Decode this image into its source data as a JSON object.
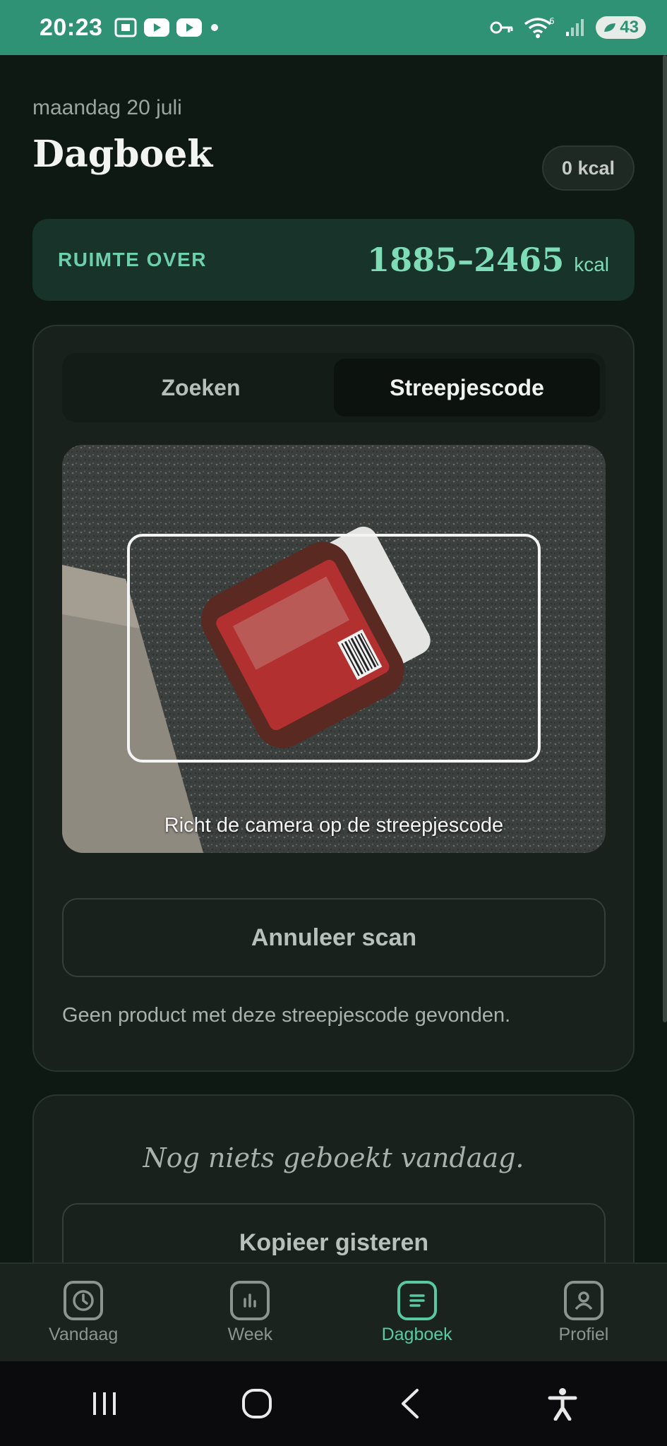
{
  "status_bar": {
    "time": "20:23",
    "battery": "43",
    "wifi_badge": "6"
  },
  "header": {
    "date": "maandag 20 juli",
    "title": "Dagboek",
    "kcal_pill": "0 kcal"
  },
  "remaining": {
    "label": "RUIMTE OVER",
    "value": "1885–2465",
    "unit": "kcal"
  },
  "scanner": {
    "tabs": [
      {
        "label": "Zoeken",
        "active": false
      },
      {
        "label": "Streepjescode",
        "active": true
      }
    ],
    "camera_hint": "Richt de camera op de streepjescode",
    "cancel_label": "Annuleer scan",
    "message": "Geen product met deze streepjescode gevonden."
  },
  "log": {
    "empty_text": "Nog niets geboekt vandaag.",
    "copy_label": "Kopieer gisteren"
  },
  "bottom_nav": {
    "items": [
      {
        "label": "Vandaag",
        "icon": "clock-icon",
        "active": false
      },
      {
        "label": "Week",
        "icon": "bar-chart-icon",
        "active": false
      },
      {
        "label": "Dagboek",
        "icon": "list-icon",
        "active": true
      },
      {
        "label": "Profiel",
        "icon": "user-icon",
        "active": false
      }
    ]
  },
  "colors": {
    "status_bar": "#2f9274",
    "accent": "#58c9a2",
    "background": "#0f1914",
    "card": "#18211c"
  }
}
